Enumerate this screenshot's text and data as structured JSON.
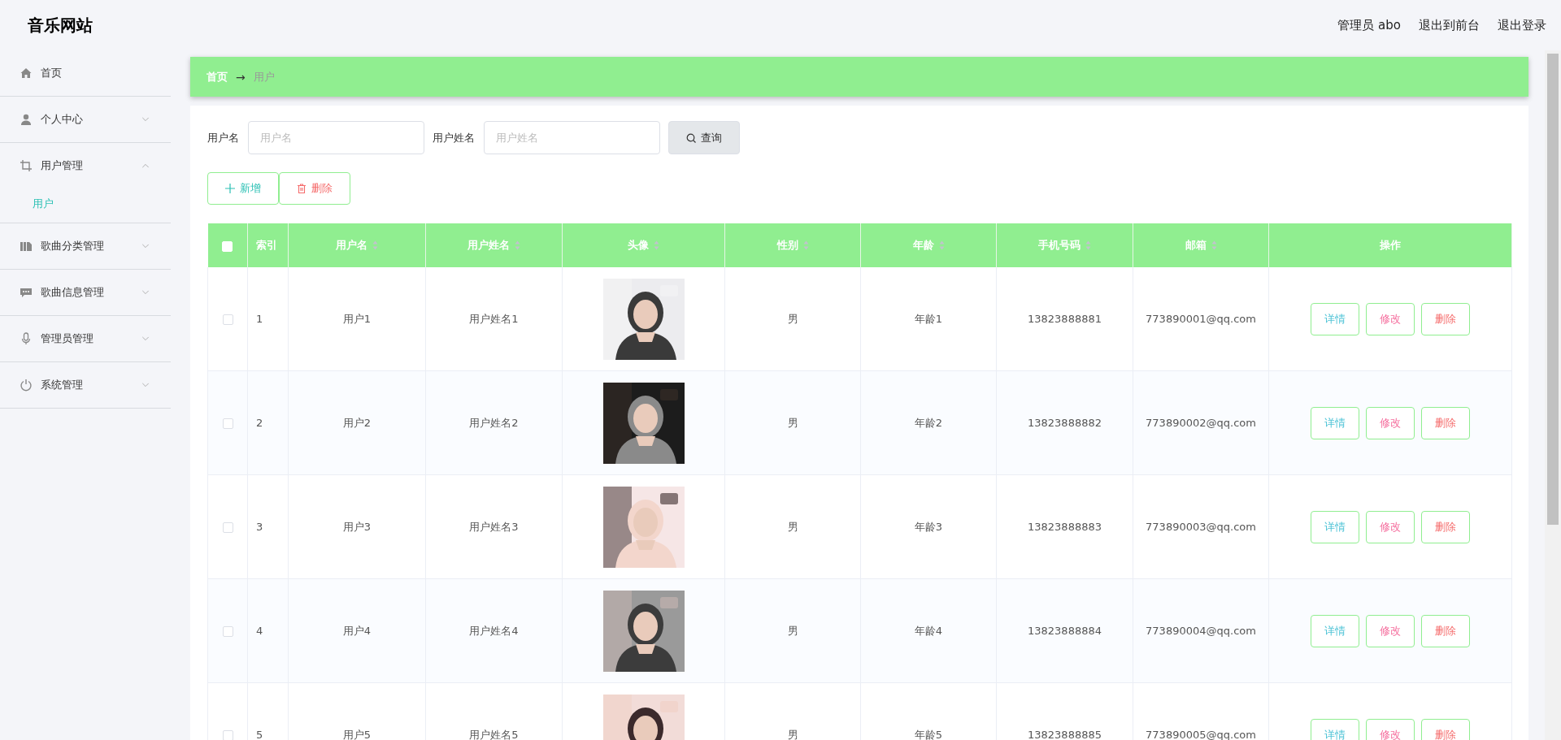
{
  "header": {
    "title": "音乐网站",
    "links": [
      "管理员 abo",
      "退出到前台",
      "退出登录"
    ]
  },
  "sidebar": {
    "items": [
      {
        "label": "首页",
        "kind": "link",
        "expanded": false
      },
      {
        "label": "个人中心",
        "kind": "submenu",
        "expanded": false
      },
      {
        "label": "用户管理",
        "kind": "submenu",
        "expanded": true,
        "children": [
          {
            "label": "用户",
            "selected": true
          }
        ]
      },
      {
        "label": "歌曲分类管理",
        "kind": "submenu",
        "expanded": false
      },
      {
        "label": "歌曲信息管理",
        "kind": "submenu",
        "expanded": false
      },
      {
        "label": "管理员管理",
        "kind": "submenu",
        "expanded": false
      },
      {
        "label": "系统管理",
        "kind": "submenu",
        "expanded": false
      }
    ]
  },
  "breadcrumb": {
    "items": [
      "首页",
      "用户"
    ],
    "separator": "→"
  },
  "search": {
    "fields": [
      {
        "label": "用户名",
        "placeholder": "用户名"
      },
      {
        "label": "用户姓名",
        "placeholder": "用户姓名"
      }
    ],
    "button": "查询"
  },
  "actions": [
    {
      "kind": "add",
      "label": "新增"
    },
    {
      "kind": "delete",
      "label": "删除"
    }
  ],
  "table": {
    "select_all": {
      "checked": false
    },
    "columns": [
      {
        "label": "索引",
        "sortable": false
      },
      {
        "label": "用户名",
        "sortable": true
      },
      {
        "label": "用户姓名",
        "sortable": true
      },
      {
        "label": "头像",
        "sortable": true
      },
      {
        "label": "性别",
        "sortable": true
      },
      {
        "label": "年龄",
        "sortable": true
      },
      {
        "label": "手机号码",
        "sortable": true
      },
      {
        "label": "邮箱",
        "sortable": true
      },
      {
        "label": "操作",
        "sortable": false
      }
    ],
    "rows": [
      {
        "checked": false,
        "cells": [
          "1",
          "用户1",
          "用户姓名1",
          {
            "kind": "picture"
          },
          "男",
          "年龄1",
          "13823888881",
          "773890001@qq.com"
        ],
        "buttons": [
          {
            "kind": "detail",
            "label": "详情"
          },
          {
            "kind": "edit",
            "label": "修改"
          },
          {
            "kind": "delete",
            "label": "删除"
          }
        ]
      },
      {
        "checked": false,
        "cells": [
          "2",
          "用户2",
          "用户姓名2",
          {
            "kind": "picture"
          },
          "男",
          "年龄2",
          "13823888882",
          "773890002@qq.com"
        ],
        "buttons": [
          {
            "kind": "detail",
            "label": "详情"
          },
          {
            "kind": "edit",
            "label": "修改"
          },
          {
            "kind": "delete",
            "label": "删除"
          }
        ]
      },
      {
        "checked": false,
        "cells": [
          "3",
          "用户3",
          "用户姓名3",
          {
            "kind": "picture"
          },
          "男",
          "年龄3",
          "13823888883",
          "773890003@qq.com"
        ],
        "buttons": [
          {
            "kind": "detail",
            "label": "详情"
          },
          {
            "kind": "edit",
            "label": "修改"
          },
          {
            "kind": "delete",
            "label": "删除"
          }
        ]
      },
      {
        "checked": false,
        "cells": [
          "4",
          "用户4",
          "用户姓名4",
          {
            "kind": "picture"
          },
          "男",
          "年龄4",
          "13823888884",
          "773890004@qq.com"
        ],
        "buttons": [
          {
            "kind": "detail",
            "label": "详情"
          },
          {
            "kind": "edit",
            "label": "修改"
          },
          {
            "kind": "delete",
            "label": "删除"
          }
        ]
      },
      {
        "checked": false,
        "cells": [
          "5",
          "用户5",
          "用户姓名5",
          {
            "kind": "picture"
          },
          "男",
          "年龄5",
          "13823888885",
          "773890005@qq.com"
        ],
        "buttons": [
          {
            "kind": "detail",
            "label": "详情"
          },
          {
            "kind": "edit",
            "label": "修改"
          },
          {
            "kind": "delete",
            "label": "删除"
          }
        ]
      }
    ]
  }
}
